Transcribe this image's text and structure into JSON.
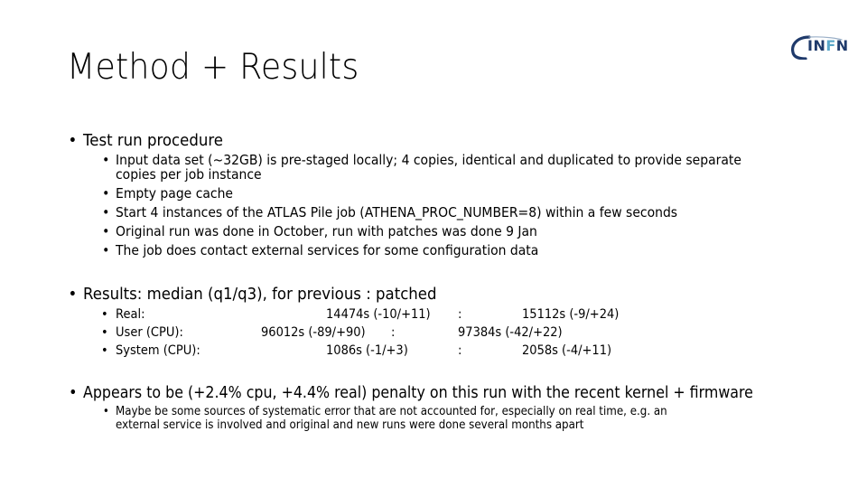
{
  "slide": {
    "title": "Method + Results",
    "logo": {
      "text_a": "IN",
      "text_b": "F",
      "text_c": "N",
      "icon": "infn-logo-icon"
    },
    "bullet_glyph": "•",
    "sections": [
      {
        "heading": "Test run procedure",
        "items": [
          "Input data set (~32GB) is pre-staged locally; 4 copies, identical and duplicated to provide separate",
          "copies per job instance",
          "Empty page cache",
          "Start 4 instances of the ATLAS Pile job (ATHENA_PROC_NUMBER=8) within a few seconds",
          "Original run was done in October, run with patches was done 9 Jan",
          "The job does contact external services for some configuration data"
        ]
      },
      {
        "heading": "Results: median (q1/q3), for previous : patched",
        "rows": [
          {
            "label": "Real:",
            "previous": "14474s (-10/+11)",
            "sep": ":",
            "patched": "15112s (-9/+24)"
          },
          {
            "label": "User (CPU):",
            "previous": "96012s (-89/+90)",
            "sep": ":",
            "patched": "97384s (-42/+22)"
          },
          {
            "label": "System (CPU):",
            "previous": "1086s (-1/+3)",
            "sep": ":",
            "patched": "2058s (-4/+11)"
          }
        ]
      },
      {
        "heading": "Appears to be (+2.4% cpu, +4.4% real) penalty on this run with the recent kernel + firmware",
        "items": [
          "Maybe be some sources of systematic error that are not accounted for, especially on real time, e.g. an",
          "external service is involved and original and new runs were done several months apart"
        ]
      }
    ]
  }
}
